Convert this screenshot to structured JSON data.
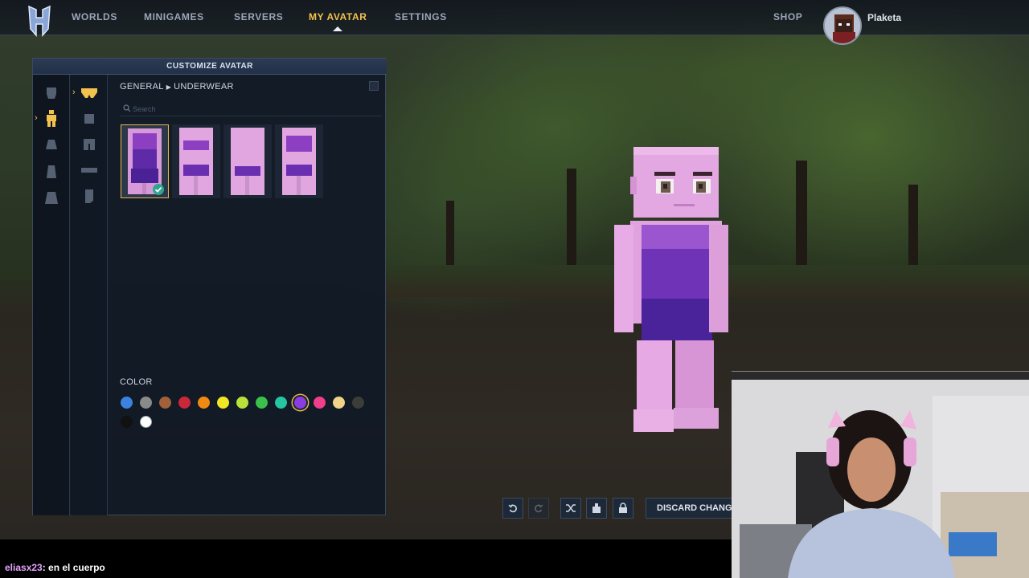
{
  "nav": {
    "items": [
      "WORLDS",
      "MINIGAMES",
      "SERVERS",
      "MY AVATAR",
      "SETTINGS"
    ],
    "active": "MY AVATAR",
    "shop": "SHOP",
    "username": "Plaketa"
  },
  "panel": {
    "title": "CUSTOMIZE AVATAR",
    "breadcrumb_root": "GENERAL",
    "breadcrumb_leaf": "UNDERWEAR",
    "search_placeholder": "Search",
    "color_label": "COLOR",
    "selected_color": "purple"
  },
  "colors": [
    "#3b82e0",
    "#8a8a8a",
    "#a0603a",
    "#c9283a",
    "#f08a10",
    "#f2e624",
    "#b6e23a",
    "#3bc04a",
    "#25c4a2",
    "#8a3de0",
    "#ee3f8a",
    "#f2d38a",
    "#3a3d38",
    "#111111",
    "#ffffff"
  ],
  "toolbar": {
    "discard_label": "DISCARD CHANGES"
  },
  "chat": {
    "user": "eliasx23",
    "message": ": en el cuerpo"
  }
}
